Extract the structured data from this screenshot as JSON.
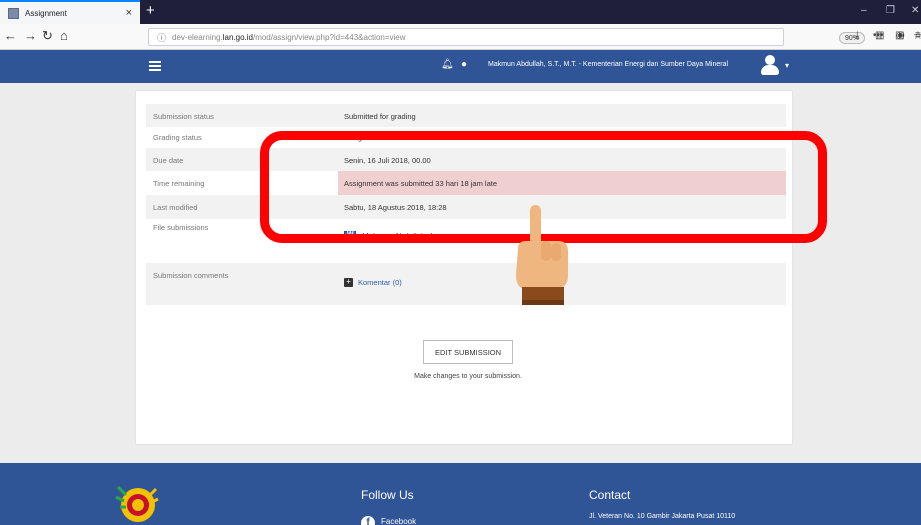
{
  "browser": {
    "tab_title": "Assignment",
    "tab_close": "×",
    "new_tab": "+",
    "url_host": "dev-elearning.lan.go.id",
    "url_path": "/mod/assign/view.php?id=443&action=view",
    "url_prefix": "dev-elearning.",
    "url_domain": "lan.go.id",
    "zoom": "90%",
    "page_actions": "•••"
  },
  "header": {
    "user_name": "Makmun Abdullah, S.T., M.T. - Kementerian Energi dan Sumber Daya Mineral"
  },
  "submission": {
    "rows": [
      {
        "label": "Submission status",
        "value": "Submitted for grading"
      },
      {
        "label": "Grading status",
        "value": "Not graded"
      },
      {
        "label": "Due date",
        "value": "Senin, 16 Juli 2018, 00.00"
      },
      {
        "label": "Time remaining",
        "value": "Assignment was submitted 33 hari 18 jam late"
      },
      {
        "label": "Last modified",
        "value": "Sabtu, 18 Agustus 2018, 18:28"
      },
      {
        "label": "File submissions",
        "value": "Makmun Abdullah.docx"
      },
      {
        "label": "Submission comments",
        "value": "Komentar (0)"
      }
    ],
    "edit_button": "EDIT SUBMISSION",
    "edit_hint": "Make changes to your submission."
  },
  "footer": {
    "follow_title": "Follow Us",
    "facebook": "Facebook",
    "contact_title": "Contact",
    "address": "Jl. Veteran No. 10 Gambir Jakarta Pusat 10110"
  },
  "colors": {
    "brand": "#2f5597",
    "late_row": "#efcfcf",
    "annotation": "#ff0000"
  },
  "icons": [
    "search-icon",
    "back-arrow-icon",
    "forward-arrow-icon",
    "reload-icon",
    "home-icon",
    "info-icon",
    "pocket-icon",
    "star-icon",
    "download-icon",
    "library-icon",
    "sidebar-icon",
    "hamburger-icon",
    "bell-icon",
    "chat-icon",
    "avatar-icon",
    "word-doc-icon",
    "plus-icon",
    "facebook-icon",
    "hand-pointer-icon"
  ]
}
